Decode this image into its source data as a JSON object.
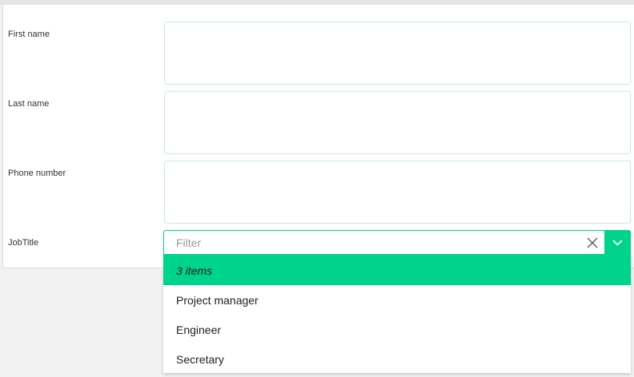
{
  "form": {
    "fields": [
      {
        "label": "First name",
        "value": ""
      },
      {
        "label": "Last name",
        "value": ""
      },
      {
        "label": "Phone number",
        "value": ""
      }
    ],
    "job_title": {
      "label": "JobTitle",
      "placeholder": "Filter",
      "count_text": "3 items",
      "options": [
        "Project manager",
        "Engineer",
        "Secretary"
      ]
    }
  },
  "colors": {
    "accent": "#00d38b",
    "field_border": "#c8ece8"
  },
  "icons": {
    "clear": "close-icon",
    "toggle": "chevron-down-icon"
  }
}
